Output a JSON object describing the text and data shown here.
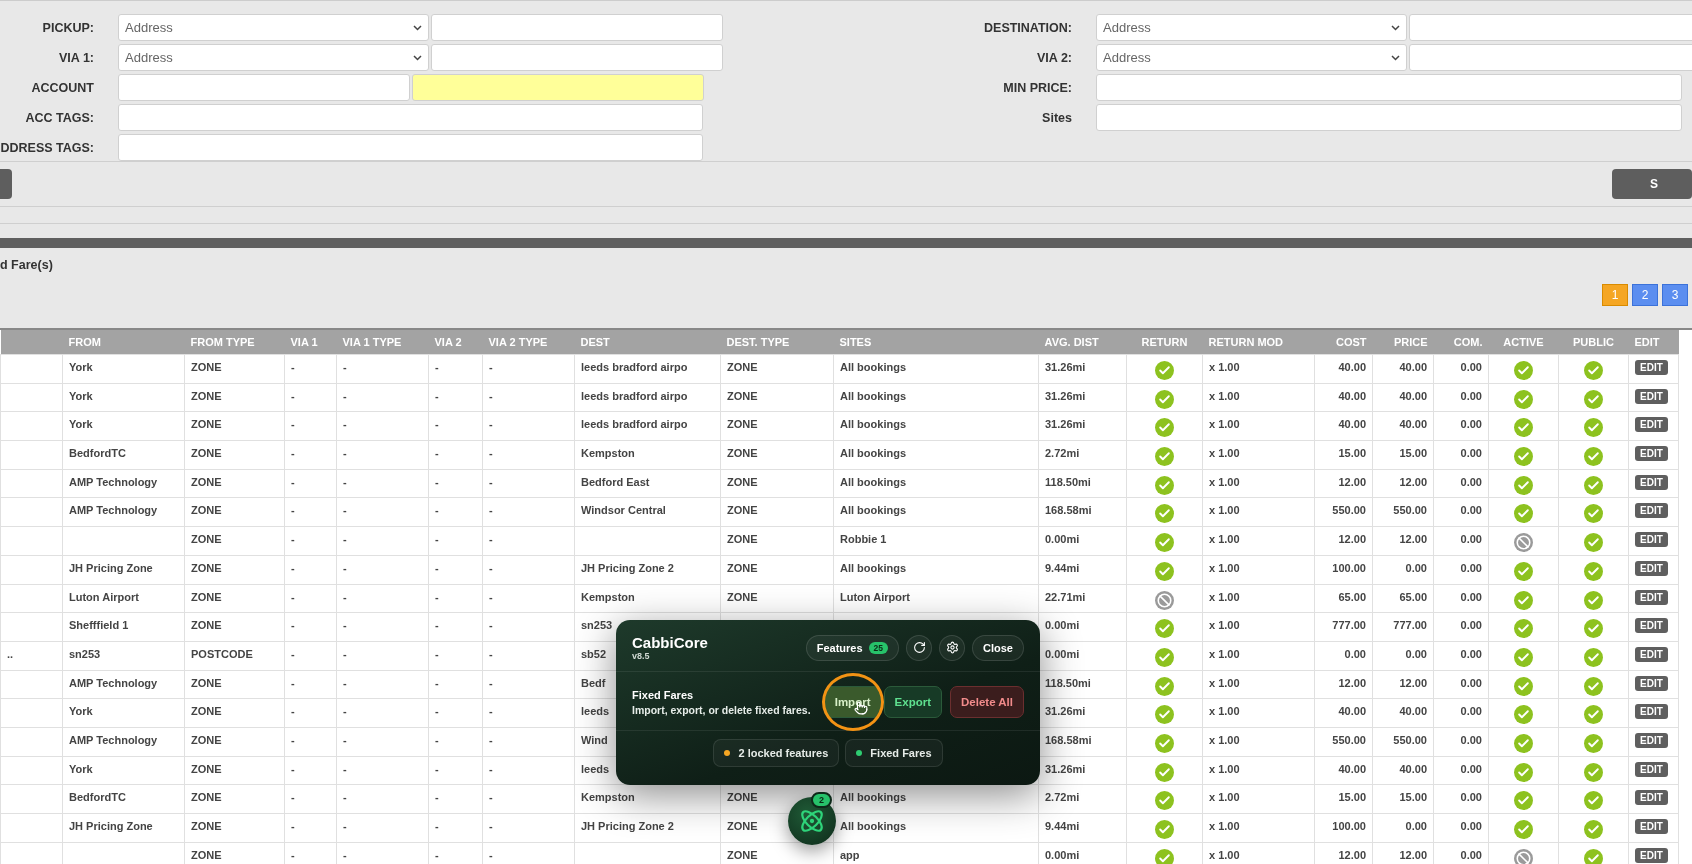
{
  "filters": {
    "left": [
      {
        "kind": "select_pair",
        "label": "PICKUP:",
        "select": "Address"
      },
      {
        "kind": "select_pair",
        "label": "VIA 1:",
        "select": "Address"
      },
      {
        "kind": "account",
        "label": "ACCOUNT"
      },
      {
        "kind": "text",
        "label": "ACC TAGS:"
      },
      {
        "kind": "text",
        "label": "DDRESS TAGS:"
      }
    ],
    "right": [
      {
        "kind": "select_pair",
        "label": "DESTINATION:",
        "select": "Address"
      },
      {
        "kind": "select_pair",
        "label": "VIA 2:",
        "select": "Address"
      },
      {
        "kind": "text",
        "label": "MIN PRICE:"
      },
      {
        "kind": "text",
        "label": "Sites"
      }
    ]
  },
  "search_button": "S",
  "list_title": "d Fare(s)",
  "pages": [
    {
      "label": "1",
      "selected": true
    },
    {
      "label": "2",
      "selected": false
    },
    {
      "label": "3",
      "selected": false
    }
  ],
  "table": {
    "columns": [
      "",
      "FROM",
      "FROM TYPE",
      "VIA 1",
      "VIA 1 TYPE",
      "VIA 2",
      "VIA 2 TYPE",
      "DEST",
      "DEST. TYPE",
      "SITES",
      "AVG. DIST",
      "RETURN",
      "RETURN MOD",
      "COST",
      "PRICE",
      "COM.",
      "ACTIVE",
      "PUBLIC",
      "EDIT"
    ],
    "rows": [
      {
        "from": "York",
        "from_type": "ZONE",
        "via_1": "-",
        "via_1_type": "-",
        "via_2": "-",
        "via_2_type": "-",
        "dest": "leeds bradford airpo",
        "dest_type": "ZONE",
        "sites": "All bookings",
        "avg_dist": "31.26mi",
        "return": true,
        "return_mod": "x 1.00",
        "cost": "40.00",
        "price": "40.00",
        "com": "0.00",
        "active": true,
        "public": true,
        "edit": "EDIT"
      },
      {
        "from": "York",
        "from_type": "ZONE",
        "via_1": "-",
        "via_1_type": "-",
        "via_2": "-",
        "via_2_type": "-",
        "dest": "leeds bradford airpo",
        "dest_type": "ZONE",
        "sites": "All bookings",
        "avg_dist": "31.26mi",
        "return": true,
        "return_mod": "x 1.00",
        "cost": "40.00",
        "price": "40.00",
        "com": "0.00",
        "active": true,
        "public": true,
        "edit": "EDIT"
      },
      {
        "from": "York",
        "from_type": "ZONE",
        "via_1": "-",
        "via_1_type": "-",
        "via_2": "-",
        "via_2_type": "-",
        "dest": "leeds bradford airpo",
        "dest_type": "ZONE",
        "sites": "All bookings",
        "avg_dist": "31.26mi",
        "return": true,
        "return_mod": "x 1.00",
        "cost": "40.00",
        "price": "40.00",
        "com": "0.00",
        "active": true,
        "public": true,
        "edit": "EDIT"
      },
      {
        "from": "BedfordTC",
        "from_type": "ZONE",
        "via_1": "-",
        "via_1_type": "-",
        "via_2": "-",
        "via_2_type": "-",
        "dest": "Kempston",
        "dest_type": "ZONE",
        "sites": "All bookings",
        "avg_dist": "2.72mi",
        "return": true,
        "return_mod": "x 1.00",
        "cost": "15.00",
        "price": "15.00",
        "com": "0.00",
        "active": true,
        "public": true,
        "edit": "EDIT"
      },
      {
        "from": "AMP Technology",
        "from_type": "ZONE",
        "via_1": "-",
        "via_1_type": "-",
        "via_2": "-",
        "via_2_type": "-",
        "dest": "Bedford East",
        "dest_type": "ZONE",
        "sites": "All bookings",
        "avg_dist": "118.50mi",
        "return": true,
        "return_mod": "x 1.00",
        "cost": "12.00",
        "price": "12.00",
        "com": "0.00",
        "active": true,
        "public": true,
        "edit": "EDIT"
      },
      {
        "from": "AMP Technology",
        "from_type": "ZONE",
        "via_1": "-",
        "via_1_type": "-",
        "via_2": "-",
        "via_2_type": "-",
        "dest": "Windsor Central",
        "dest_type": "ZONE",
        "sites": "All bookings",
        "avg_dist": "168.58mi",
        "return": true,
        "return_mod": "x 1.00",
        "cost": "550.00",
        "price": "550.00",
        "com": "0.00",
        "active": true,
        "public": true,
        "edit": "EDIT"
      },
      {
        "from_type": "ZONE",
        "via_1": "-",
        "via_1_type": "-",
        "via_2": "-",
        "via_2_type": "-",
        "dest_type": "ZONE",
        "sites": "Robbie 1",
        "avg_dist": "0.00mi",
        "return": true,
        "return_mod": "x 1.00",
        "cost": "12.00",
        "price": "12.00",
        "com": "0.00",
        "active": false,
        "public": true,
        "edit": "EDIT"
      },
      {
        "from": "JH Pricing Zone",
        "from_type": "ZONE",
        "via_1": "-",
        "via_1_type": "-",
        "via_2": "-",
        "via_2_type": "-",
        "dest": "JH Pricing Zone 2",
        "dest_type": "ZONE",
        "sites": "All bookings",
        "avg_dist": "9.44mi",
        "return": true,
        "return_mod": "x 1.00",
        "cost": "100.00",
        "price": "0.00",
        "com": "0.00",
        "active": true,
        "public": true,
        "edit": "EDIT"
      },
      {
        "from": "Luton Airport",
        "from_type": "ZONE",
        "via_1": "-",
        "via_1_type": "-",
        "via_2": "-",
        "via_2_type": "-",
        "dest": "Kempston",
        "dest_type": "ZONE",
        "sites": "Luton Airport",
        "avg_dist": "22.71mi",
        "return": false,
        "return_mod": "x 1.00",
        "cost": "65.00",
        "price": "65.00",
        "com": "0.00",
        "active": true,
        "public": true,
        "edit": "EDIT"
      },
      {
        "from": "Shefffield 1",
        "from_type": "ZONE",
        "via_1": "-",
        "via_1_type": "-",
        "via_2": "-",
        "via_2_type": "-",
        "dest": "sn253",
        "avg_dist": "0.00mi",
        "return": true,
        "return_mod": "x 1.00",
        "cost": "777.00",
        "price": "777.00",
        "com": "0.00",
        "active": true,
        "public": true,
        "edit": "EDIT"
      },
      {
        "column_1": "..",
        "from": "sn253",
        "from_type": "POSTCODE",
        "via_1": "-",
        "via_1_type": "-",
        "via_2": "-",
        "via_2_type": "-",
        "dest": "sb52",
        "avg_dist": "0.00mi",
        "return": true,
        "return_mod": "x 1.00",
        "cost": "0.00",
        "price": "0.00",
        "com": "0.00",
        "active": true,
        "public": true,
        "edit": "EDIT"
      },
      {
        "from": "AMP Technology",
        "from_type": "ZONE",
        "via_1": "-",
        "via_1_type": "-",
        "via_2": "-",
        "via_2_type": "-",
        "dest": "Bedf",
        "avg_dist": "118.50mi",
        "return": true,
        "return_mod": "x 1.00",
        "cost": "12.00",
        "price": "12.00",
        "com": "0.00",
        "active": true,
        "public": true,
        "edit": "EDIT"
      },
      {
        "from": "York",
        "from_type": "ZONE",
        "via_1": "-",
        "via_1_type": "-",
        "via_2": "-",
        "via_2_type": "-",
        "dest": "leeds",
        "avg_dist": "31.26mi",
        "return": true,
        "return_mod": "x 1.00",
        "cost": "40.00",
        "price": "40.00",
        "com": "0.00",
        "active": true,
        "public": true,
        "edit": "EDIT"
      },
      {
        "from": "AMP Technology",
        "from_type": "ZONE",
        "via_1": "-",
        "via_1_type": "-",
        "via_2": "-",
        "via_2_type": "-",
        "dest": "Wind",
        "avg_dist": "168.58mi",
        "return": true,
        "return_mod": "x 1.00",
        "cost": "550.00",
        "price": "550.00",
        "com": "0.00",
        "active": true,
        "public": true,
        "edit": "EDIT"
      },
      {
        "from": "York",
        "from_type": "ZONE",
        "via_1": "-",
        "via_1_type": "-",
        "via_2": "-",
        "via_2_type": "-",
        "dest": "leeds",
        "avg_dist": "31.26mi",
        "return": true,
        "return_mod": "x 1.00",
        "cost": "40.00",
        "price": "40.00",
        "com": "0.00",
        "active": true,
        "public": true,
        "edit": "EDIT"
      },
      {
        "from": "BedfordTC",
        "from_type": "ZONE",
        "via_1": "-",
        "via_1_type": "-",
        "via_2": "-",
        "via_2_type": "-",
        "dest": "Kempston",
        "dest_type": "ZONE",
        "sites": "All bookings",
        "avg_dist": "2.72mi",
        "return": true,
        "return_mod": "x 1.00",
        "cost": "15.00",
        "price": "15.00",
        "com": "0.00",
        "active": true,
        "public": true,
        "edit": "EDIT"
      },
      {
        "from": "JH Pricing Zone",
        "from_type": "ZONE",
        "via_1": "-",
        "via_1_type": "-",
        "via_2": "-",
        "via_2_type": "-",
        "dest": "JH Pricing Zone 2",
        "dest_type": "ZONE",
        "sites": "All bookings",
        "avg_dist": "9.44mi",
        "return": true,
        "return_mod": "x 1.00",
        "cost": "100.00",
        "price": "0.00",
        "com": "0.00",
        "active": true,
        "public": true,
        "edit": "EDIT"
      },
      {
        "from_type": "ZONE",
        "via_1": "-",
        "via_1_type": "-",
        "via_2": "-",
        "via_2_type": "-",
        "dest_type": "ZONE",
        "sites": "app",
        "avg_dist": "0.00mi",
        "return": true,
        "return_mod": "x 1.00",
        "cost": "12.00",
        "price": "12.00",
        "com": "0.00",
        "active": false,
        "public": true,
        "edit": "EDIT"
      }
    ]
  },
  "panel": {
    "title": "CabbiCore",
    "version": "v8.5",
    "features_button": "Features",
    "features_count": "25",
    "close_button": "Close",
    "section_title": "Fixed Fares",
    "section_text": "Import, export, or delete fixed fares.",
    "actions": [
      {
        "kind": "import",
        "label": "Import",
        "highlighted": true
      },
      {
        "kind": "export",
        "label": "Export",
        "highlighted": false
      },
      {
        "kind": "delete",
        "label": "Delete All",
        "highlighted": false
      }
    ],
    "chips": [
      {
        "label": "2 locked features",
        "color": "#f5a623"
      },
      {
        "label": "Fixed Fares",
        "color": "#2ecc71"
      }
    ]
  },
  "launcher": {
    "badge": "2"
  }
}
